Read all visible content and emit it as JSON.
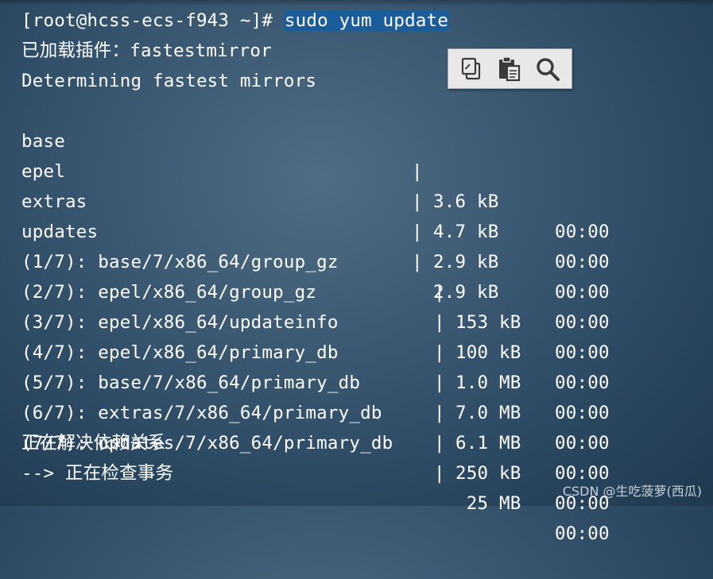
{
  "terminal": {
    "prompt": "[root@hcss-ecs-f943 ~]# ",
    "command": "sudo yum update",
    "plugins_line": "已加载插件：fastestmirror",
    "determining_line": "Determining fastest mirrors",
    "repos": [
      {
        "name": "base",
        "sep": "|",
        "size": "3.6 kB",
        "time": "00:00"
      },
      {
        "name": "epel",
        "sep": "|",
        "size": "4.7 kB",
        "time": "00:00"
      },
      {
        "name": "extras",
        "sep": "|",
        "size": "2.9 kB",
        "time": "00:00"
      },
      {
        "name": "updates",
        "sep": "|",
        "size": "2.9 kB",
        "time": "00:00"
      }
    ],
    "downloads": [
      {
        "name": "(1/7): base/7/x86_64/group_gz",
        "sep": "|",
        "size": "153 kB",
        "time": "00:00"
      },
      {
        "name": "(2/7): epel/x86_64/group_gz",
        "sep": "|",
        "size": "100 kB",
        "time": "00:00"
      },
      {
        "name": "(3/7): epel/x86_64/updateinfo",
        "sep": "|",
        "size": "1.0 MB",
        "time": "00:00"
      },
      {
        "name": "(4/7): epel/x86_64/primary_db",
        "sep": "|",
        "size": "7.0 MB",
        "time": "00:00"
      },
      {
        "name": "(5/7): base/7/x86_64/primary_db",
        "sep": "|",
        "size": "6.1 MB",
        "time": "00:00"
      },
      {
        "name": "(6/7): extras/7/x86_64/primary_db",
        "sep": "|",
        "size": "250 kB",
        "time": "00:00"
      },
      {
        "name": "(7/7): updates/7/x86_64/primary_db",
        "sep": "|",
        "size": " 25 MB",
        "time": "00:00"
      }
    ],
    "resolving_line": "正在解决依赖关系",
    "checking_line": "--> 正在检查事务"
  },
  "toolbar": {
    "buttons": [
      {
        "icon": "copy-icon"
      },
      {
        "icon": "paste-icon"
      },
      {
        "icon": "search-icon"
      }
    ]
  },
  "watermark": "CSDN @生吃菠萝(西瓜)",
  "colors": {
    "command_highlight": "#1b5c9b",
    "text": "#ffffff"
  }
}
